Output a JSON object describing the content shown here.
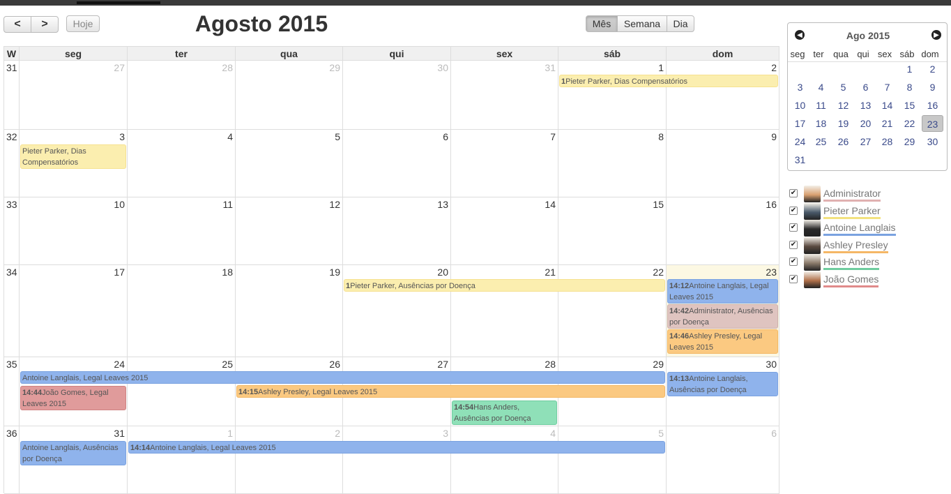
{
  "toolbar": {
    "prev_icon": "chevron-left-icon",
    "next_icon": "chevron-right-icon",
    "prev_glyph": "<",
    "next_glyph": ">",
    "today_label": "Hoje",
    "title": "Agosto 2015",
    "views": [
      "Mês",
      "Semana",
      "Dia"
    ],
    "active_view": "Mês"
  },
  "calendar": {
    "week_header": "W",
    "weekdays": [
      "seg",
      "ter",
      "qua",
      "qui",
      "sex",
      "sáb",
      "dom"
    ],
    "weeks": [
      {
        "num": "31",
        "days": [
          "27",
          "28",
          "29",
          "30",
          "31",
          "1",
          "2"
        ],
        "other": [
          true,
          true,
          true,
          true,
          true,
          false,
          false
        ]
      },
      {
        "num": "32",
        "days": [
          "3",
          "4",
          "5",
          "6",
          "7",
          "8",
          "9"
        ],
        "other": [
          false,
          false,
          false,
          false,
          false,
          false,
          false
        ]
      },
      {
        "num": "33",
        "days": [
          "10",
          "11",
          "12",
          "13",
          "14",
          "15",
          "16"
        ],
        "other": [
          false,
          false,
          false,
          false,
          false,
          false,
          false
        ]
      },
      {
        "num": "34",
        "days": [
          "17",
          "18",
          "19",
          "20",
          "21",
          "22",
          "23"
        ],
        "other": [
          false,
          false,
          false,
          false,
          false,
          false,
          false
        ]
      },
      {
        "num": "35",
        "days": [
          "24",
          "25",
          "26",
          "27",
          "28",
          "29",
          "30"
        ],
        "other": [
          false,
          false,
          false,
          false,
          false,
          false,
          false
        ]
      },
      {
        "num": "36",
        "days": [
          "31",
          "1",
          "2",
          "3",
          "4",
          "5",
          "6"
        ],
        "other": [
          false,
          true,
          true,
          true,
          true,
          true,
          true
        ]
      }
    ],
    "today": "23",
    "events": [
      {
        "time": "1",
        "text": "Pieter Parker, Dias Compensatórios",
        "color": "yellow",
        "week": 0,
        "start": 5,
        "span": 2,
        "row": 0
      },
      {
        "time": "",
        "text": "Pieter Parker, Dias Compensatórios",
        "color": "yellow",
        "week": 1,
        "start": 0,
        "span": 1,
        "row": 0,
        "lines": 2
      },
      {
        "time": "1",
        "text": "Pieter Parker, Ausências por Doença",
        "color": "yellow",
        "week": 3,
        "start": 3,
        "span": 3,
        "row": 0
      },
      {
        "time": "14:12",
        "text": "Antoine Langlais, Legal Leaves 2015",
        "color": "blue",
        "week": 3,
        "start": 6,
        "span": 1,
        "row": 0,
        "lines": 2
      },
      {
        "time": "14:42",
        "text": "Administrator, Ausências por Doença",
        "color": "pink",
        "week": 3,
        "start": 6,
        "span": 1,
        "row": 1,
        "lines": 2
      },
      {
        "time": "14:46",
        "text": "Ashley Presley, Legal Leaves 2015",
        "color": "orange",
        "week": 3,
        "start": 6,
        "span": 1,
        "row": 2,
        "lines": 2
      },
      {
        "time": "",
        "text": "Antoine Langlais, Legal Leaves 2015",
        "color": "blue",
        "week": 4,
        "start": 0,
        "span": 6,
        "row": 0
      },
      {
        "time": "14:13",
        "text": "Antoine Langlais, Ausências por Doença",
        "color": "blue",
        "week": 4,
        "start": 6,
        "span": 1,
        "row": 0,
        "lines": 2
      },
      {
        "time": "14:44",
        "text": "João Gomes, Legal Leaves 2015",
        "color": "red",
        "week": 4,
        "start": 0,
        "span": 1,
        "row": 1,
        "lines": 2
      },
      {
        "time": "14:15",
        "text": "Ashley Presley, Legal Leaves 2015",
        "color": "orange",
        "week": 4,
        "start": 2,
        "span": 4,
        "row": 1
      },
      {
        "time": "14:54",
        "text": "Hans Anders, Ausências por Doença",
        "color": "green",
        "week": 4,
        "start": 4,
        "span": 1,
        "row": 2,
        "lines": 2
      },
      {
        "time": "",
        "text": "Antoine Langlais, Ausências por Doença",
        "color": "blue",
        "week": 5,
        "start": 0,
        "span": 1,
        "row": 0,
        "lines": 2
      },
      {
        "time": "14:14",
        "text": "Antoine Langlais, Legal Leaves 2015",
        "color": "blue",
        "week": 5,
        "start": 1,
        "span": 5,
        "row": 0
      }
    ]
  },
  "mini_calendar": {
    "title": "Ago 2015",
    "prev_icon": "circle-arrow-left-icon",
    "next_icon": "circle-arrow-right-icon",
    "prev_glyph": "◀",
    "next_glyph": "▶",
    "weekdays": [
      "seg",
      "ter",
      "qua",
      "qui",
      "sex",
      "sáb",
      "dom"
    ],
    "weeks": [
      [
        "",
        "",
        "",
        "",
        "",
        "1",
        "2"
      ],
      [
        "3",
        "4",
        "5",
        "6",
        "7",
        "8",
        "9"
      ],
      [
        "10",
        "11",
        "12",
        "13",
        "14",
        "15",
        "16"
      ],
      [
        "17",
        "18",
        "19",
        "20",
        "21",
        "22",
        "23"
      ],
      [
        "24",
        "25",
        "26",
        "27",
        "28",
        "29",
        "30"
      ],
      [
        "31",
        "",
        "",
        "",
        "",
        "",
        ""
      ]
    ],
    "selected": "23"
  },
  "users": [
    {
      "name": "Administrator",
      "underline": "#e0b0b0",
      "avatar": "#d9a070",
      "checked": true,
      "check_glyph": "✔"
    },
    {
      "name": "Pieter Parker",
      "underline": "#f3e27f",
      "avatar": "#4a5a6a",
      "checked": true,
      "check_glyph": "✔"
    },
    {
      "name": "Antoine Langlais",
      "underline": "#7aa2e0",
      "avatar": "#2a2a2a",
      "checked": true,
      "check_glyph": "✔"
    },
    {
      "name": "Ashley Presley",
      "underline": "#f5b766",
      "avatar": "#5a4a40",
      "checked": true,
      "check_glyph": "✔"
    },
    {
      "name": "Hans Anders",
      "underline": "#6fcc9f",
      "avatar": "#8a7a6a",
      "checked": true,
      "check_glyph": "✔"
    },
    {
      "name": "João Gomes",
      "underline": "#e08a8a",
      "avatar": "#b0704a",
      "checked": true,
      "check_glyph": "✔"
    }
  ]
}
